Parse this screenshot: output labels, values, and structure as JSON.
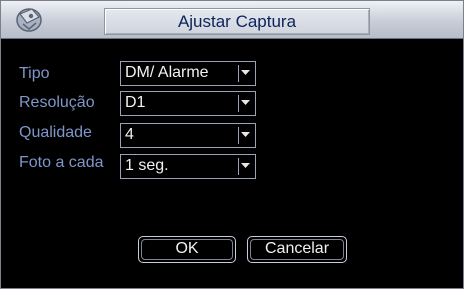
{
  "dialog": {
    "title": "Ajustar Captura",
    "icon": "camera-icon"
  },
  "fields": [
    {
      "label": "Tipo",
      "value": "DM/ Alarme"
    },
    {
      "label": "Resolução",
      "value": "D1"
    },
    {
      "label": "Qualidade",
      "value": "4"
    },
    {
      "label": "Foto a cada",
      "value": "1 seg."
    }
  ],
  "buttons": {
    "ok": "OK",
    "cancel": "Cancelar"
  }
}
